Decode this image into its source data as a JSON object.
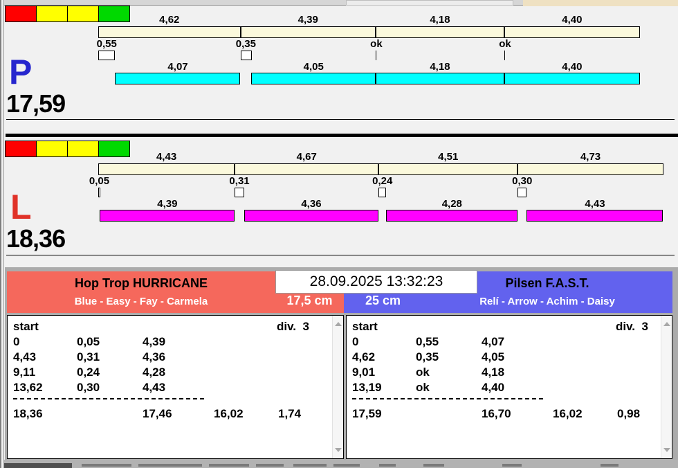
{
  "datetime": "28.09.2025 13:32:23",
  "traffic_light_colors": [
    "#FF0000",
    "#FFFF00",
    "#FFFF00",
    "#00D900"
  ],
  "lanes": [
    {
      "id": "right-lane",
      "letter": "P",
      "letter_color": "#2626CE",
      "run_bar_color": "#00FFFF",
      "total": "17,59",
      "split_labels": [
        "4,62",
        "4,39",
        "4,18",
        "4,40"
      ],
      "loss_labels": [
        "0,55",
        "0,35",
        "ok",
        "ok"
      ],
      "run_labels": [
        "4,07",
        "4,05",
        "4,18",
        "4,40"
      ],
      "cum_labels": [
        "0",
        "4,62",
        "9,01",
        "13,19"
      ]
    },
    {
      "id": "left-lane",
      "letter": "L",
      "letter_color": "#E03228",
      "run_bar_color": "#FF00FF",
      "total": "18,36",
      "split_labels": [
        "4,43",
        "4,67",
        "4,51",
        "4,73"
      ],
      "loss_labels": [
        "0,05",
        "0,31",
        "0,24",
        "0,30"
      ],
      "run_labels": [
        "4,39",
        "4,36",
        "4,28",
        "4,43"
      ],
      "cum_labels": [
        "0",
        "4,43",
        "9,11",
        "13,62"
      ]
    }
  ],
  "teams": [
    {
      "name": "Hop Trop HURRICANE",
      "dogs": "Blue - Easy - Fay - Carmela",
      "jump_height": "17,5 cm",
      "color": "#F5685C",
      "table": {
        "start_label": "start",
        "division": "div.  3",
        "rows": [
          [
            "0",
            "0,05",
            "4,39"
          ],
          [
            "4,43",
            "0,31",
            "4,36"
          ],
          [
            "9,11",
            "0,24",
            "4,28"
          ],
          [
            "13,62",
            "0,30",
            "4,43"
          ]
        ],
        "totals": [
          "18,36",
          "17,46",
          "16,02",
          "1,74"
        ]
      }
    },
    {
      "name": "Pilsen F.A.S.T.",
      "dogs": "Relí - Arrow - Achim - Daisy",
      "jump_height": "25 cm",
      "color": "#6262EE",
      "table": {
        "start_label": "start",
        "division": "div.  3",
        "rows": [
          [
            "0",
            "0,55",
            "4,07"
          ],
          [
            "4,62",
            "0,35",
            "4,05"
          ],
          [
            "9,01",
            "ok",
            "4,18"
          ],
          [
            "13,19",
            "ok",
            "4,40"
          ]
        ],
        "totals": [
          "17,59",
          "16,70",
          "16,02",
          "0,98"
        ]
      }
    }
  ]
}
